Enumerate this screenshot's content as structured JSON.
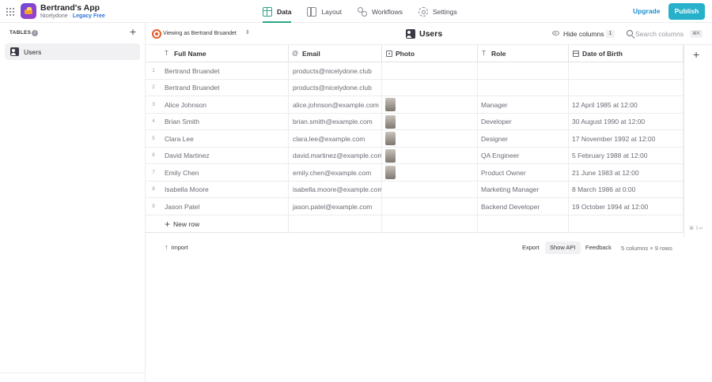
{
  "app": {
    "name": "Bertrand's App",
    "owner": "Nicelydone",
    "separator": "·",
    "plan": "Legacy Free"
  },
  "nav": {
    "tabs": [
      {
        "label": "Data",
        "icon": "data-grid-icon",
        "active": true
      },
      {
        "label": "Layout",
        "icon": "layout-icon",
        "active": false
      },
      {
        "label": "Workflows",
        "icon": "workflows-icon",
        "active": false
      },
      {
        "label": "Settings",
        "icon": "gear-icon",
        "active": false
      }
    ],
    "upgrade_label": "Upgrade",
    "publish_label": "Publish"
  },
  "sidebar": {
    "section_label": "TABLES",
    "info_glyph": "i",
    "add_glyph": "+",
    "items": [
      {
        "label": "Users",
        "icon": "table-icon"
      }
    ]
  },
  "toolbar": {
    "viewing_as": "Viewing as Bertrand Bruandet",
    "switch_glyph": "⇕",
    "table_title": "Users",
    "hide_columns_label": "Hide columns",
    "hidden_count": "1",
    "search_placeholder": "Search columns",
    "shortcut": "⌘K"
  },
  "table": {
    "columns": [
      {
        "label": "Full Name",
        "icon": "text-icon"
      },
      {
        "label": "Email",
        "icon": "at-icon"
      },
      {
        "label": "Photo",
        "icon": "image-icon"
      },
      {
        "label": "Role",
        "icon": "text-icon"
      },
      {
        "label": "Date of Birth",
        "icon": "calendar-icon"
      }
    ],
    "rows": [
      {
        "n": "1",
        "name": "Bertrand Bruandet",
        "email": "products@nicelydone.club",
        "photo": false,
        "role": "",
        "dob": ""
      },
      {
        "n": "2",
        "name": "Bertrand Bruandet",
        "email": "products@nicelydone.club",
        "photo": false,
        "role": "",
        "dob": ""
      },
      {
        "n": "3",
        "name": "Alice Johnson",
        "email": "alice.johnson@example.com",
        "photo": true,
        "role": "Manager",
        "dob": "12 April 1985 at 12:00"
      },
      {
        "n": "4",
        "name": "Brian Smith",
        "email": "brian.smith@example.com",
        "photo": true,
        "role": "Developer",
        "dob": "30 August 1990 at 12:00"
      },
      {
        "n": "5",
        "name": "Clara Lee",
        "email": "clara.lee@example.com",
        "photo": true,
        "role": "Designer",
        "dob": "17 November 1992 at 12:00"
      },
      {
        "n": "6",
        "name": "David Martinez",
        "email": "david.martinez@example.com",
        "photo": true,
        "role": "QA Engineer",
        "dob": "5 February 1988 at 12:00"
      },
      {
        "n": "7",
        "name": "Emily Chen",
        "email": "emily.chen@example.com",
        "photo": true,
        "role": "Product Owner",
        "dob": "21 June 1983 at 12:00"
      },
      {
        "n": "8",
        "name": "Isabella Moore",
        "email": " isabella.moore@example.com",
        "photo": false,
        "role": " Marketing Manager",
        "dob": "8 March 1986 at 0:00"
      },
      {
        "n": "9",
        "name": "Jason Patel",
        "email": " jason.patel@example.com",
        "photo": false,
        "role": "Backend Developer",
        "dob": "19 October 1994 at 12:00"
      }
    ],
    "new_row_label": "New row",
    "add_column_glyph": "+",
    "row_shortcut": "⌘ ⇧↵"
  },
  "footer": {
    "import_label": "Import",
    "export_label": "Export",
    "show_api_label": "Show API",
    "feedback_label": "Feedback",
    "summary": "5 columns × 9 rows"
  }
}
